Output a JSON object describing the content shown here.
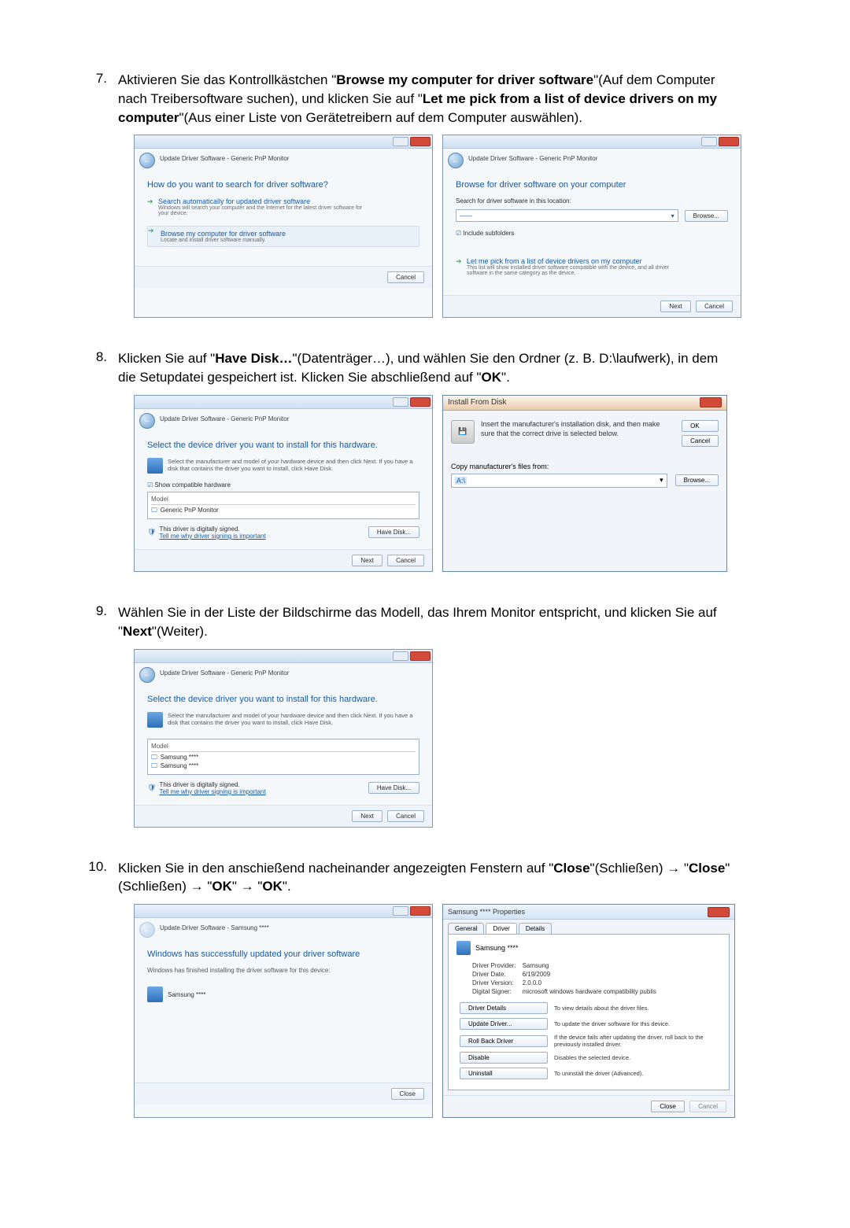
{
  "steps": {
    "s7": {
      "number": "7.",
      "text_before_bold1": "Aktivieren Sie das Kontrollkästchen \"",
      "bold1": "Browse my computer for driver software",
      "text_mid1": "\"(Auf dem Computer nach Treibersoftware suchen), und klicken Sie auf \"",
      "bold2": "Let me pick from a list of device drivers on my computer",
      "text_after": "\"(Aus einer Liste von Gerätetreibern auf dem Computer auswählen)."
    },
    "s8": {
      "number": "8.",
      "text_before": "Klicken Sie auf \"",
      "bold1": "Have Disk…",
      "text_mid": "\"(Datenträger…), und wählen Sie den Ordner (z. B. D:\\laufwerk), in dem die Setupdatei gespeichert ist. Klicken Sie abschließend auf \"",
      "bold2": "OK",
      "text_after": "\"."
    },
    "s9": {
      "number": "9.",
      "text_before": "Wählen Sie in der Liste der Bildschirme das Modell, das Ihrem Monitor entspricht, und klicken Sie auf \"",
      "bold1": "Next",
      "text_after": "\"(Weiter)."
    },
    "s10": {
      "number": "10.",
      "text_before": "Klicken Sie in den anschießend nacheinander angezeigten Fenstern auf \"",
      "bold1": "Close",
      "text_mid1": "\"(Schließen) → \"",
      "bold2": "Close",
      "text_mid2": "\"(Schließen) → \"",
      "bold3": "OK",
      "text_mid3": "\" → \"",
      "bold4": "OK",
      "text_after": "\"."
    }
  },
  "dlg7a": {
    "crumb": "Update Driver Software - Generic PnP Monitor",
    "heading": "How do you want to search for driver software?",
    "opt1_title": "Search automatically for updated driver software",
    "opt1_desc": "Windows will search your computer and the Internet for the latest driver software for your device.",
    "opt2_title": "Browse my computer for driver software",
    "opt2_desc": "Locate and install driver software manually.",
    "cancel": "Cancel"
  },
  "dlg7b": {
    "crumb": "Update Driver Software - Generic PnP Monitor",
    "heading": "Browse for driver software on your computer",
    "search_label": "Search for driver software in this location:",
    "path_value": "——",
    "browse": "Browse...",
    "include": "Include subfolders",
    "opt_title": "Let me pick from a list of device drivers on my computer",
    "opt_desc": "This list will show installed driver software compatible with the device, and all driver software in the same category as the device.",
    "next": "Next",
    "cancel": "Cancel"
  },
  "dlg8a": {
    "crumb": "Update Driver Software - Generic PnP Monitor",
    "heading": "Select the device driver you want to install for this hardware.",
    "hint": "Select the manufacturer and model of your hardware device and then click Next. If you have a disk that contains the driver you want to install, click Have Disk.",
    "show_compat": "Show compatible hardware",
    "model": "Model",
    "item1": "Generic PnP Monitor",
    "signed": "This driver is digitally signed.",
    "signed_link": "Tell me why driver signing is important",
    "have_disk": "Have Disk...",
    "next": "Next",
    "cancel": "Cancel"
  },
  "dlg8b": {
    "title": "Install From Disk",
    "msg": "Insert the manufacturer's installation disk, and then make sure that the correct drive is selected below.",
    "ok": "OK",
    "cancel": "Cancel",
    "copy_label": "Copy manufacturer's files from:",
    "path": "A:\\",
    "browse": "Browse..."
  },
  "dlg9": {
    "crumb": "Update Driver Software - Generic PnP Monitor",
    "heading": "Select the device driver you want to install for this hardware.",
    "hint": "Select the manufacturer and model of your hardware device and then click Next. If you have a disk that contains the driver you want to install, click Have Disk.",
    "model": "Model",
    "item1": "Samsung ****",
    "item2": "Samsung ****",
    "signed": "This driver is digitally signed.",
    "signed_link": "Tell me why driver signing is important",
    "have_disk": "Have Disk...",
    "next": "Next",
    "cancel": "Cancel"
  },
  "dlg10a": {
    "crumb": "Update Driver Software - Samsung ****",
    "heading": "Windows has successfully updated your driver software",
    "line": "Windows has finished installing the driver software for this device:",
    "device": "Samsung ****",
    "close": "Close"
  },
  "dlg10b": {
    "title": "Samsung **** Properties",
    "tab_general": "General",
    "tab_driver": "Driver",
    "tab_details": "Details",
    "devname": "Samsung ****",
    "rows": {
      "provider_l": "Driver Provider:",
      "provider_v": "Samsung",
      "date_l": "Driver Date:",
      "date_v": "6/19/2009",
      "version_l": "Driver Version:",
      "version_v": "2.0.0.0",
      "signer_l": "Digital Signer:",
      "signer_v": "microsoft windows hardware compatibility publis"
    },
    "actions": {
      "details_btn": "Driver Details",
      "details_txt": "To view details about the driver files.",
      "update_btn": "Update Driver...",
      "update_txt": "To update the driver software for this device.",
      "rollback_btn": "Roll Back Driver",
      "rollback_txt": "If the device fails after updating the driver, roll back to the previously installed driver.",
      "disable_btn": "Disable",
      "disable_txt": "Disables the selected device.",
      "uninstall_btn": "Uninstall",
      "uninstall_txt": "To uninstall the driver (Advanced)."
    },
    "close": "Close",
    "cancel": "Cancel"
  }
}
